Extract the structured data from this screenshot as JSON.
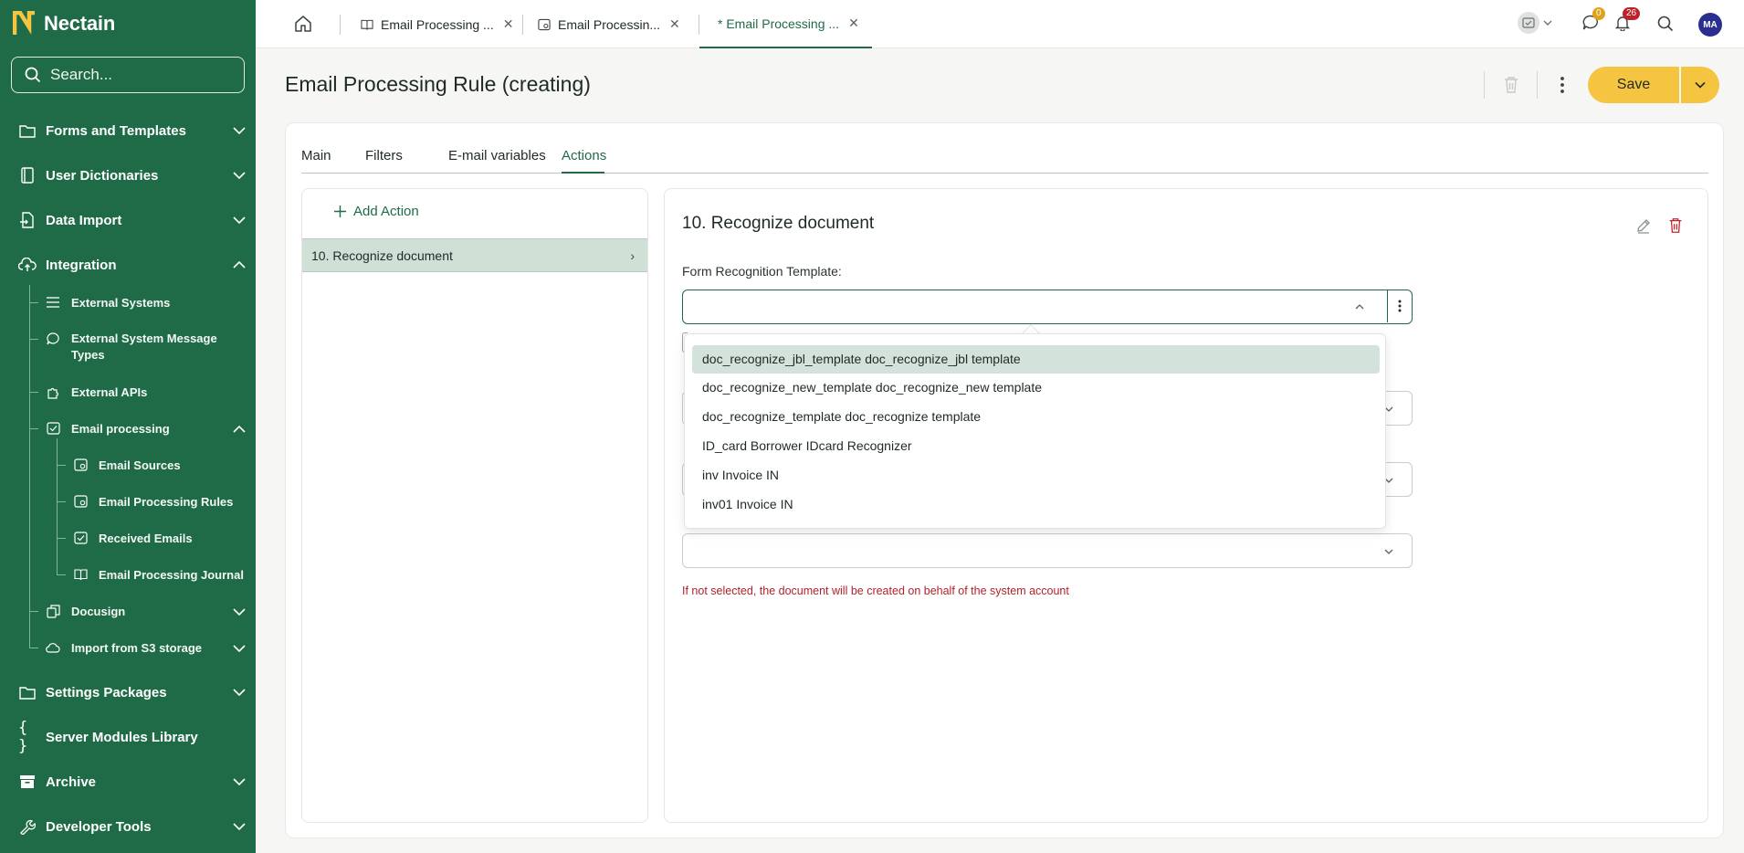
{
  "brand": {
    "name": "Nectain"
  },
  "sidebar": {
    "search_placeholder": "Search...",
    "items": [
      {
        "label": "Forms and Templates",
        "icon": "folder-icon",
        "expanded": false
      },
      {
        "label": "User Dictionaries",
        "icon": "book-icon",
        "expanded": false
      },
      {
        "label": "Data Import",
        "icon": "file-import-icon",
        "expanded": false
      },
      {
        "label": "Integration",
        "icon": "cloud-upload-icon",
        "expanded": true
      },
      {
        "label": "Settings Packages",
        "icon": "folder-icon",
        "expanded": false
      },
      {
        "label": "Server Modules Library",
        "icon": "braces-icon",
        "expanded": false
      },
      {
        "label": "Archive",
        "icon": "archive-icon",
        "expanded": false
      },
      {
        "label": "Developer Tools",
        "icon": "wrench-icon",
        "expanded": false
      }
    ],
    "integration_children": [
      {
        "label": "External Systems",
        "icon": "list-icon"
      },
      {
        "label": "External System Message Types",
        "icon": "message-icon"
      },
      {
        "label": "External APIs",
        "icon": "puzzle-icon"
      },
      {
        "label": "Email processing",
        "icon": "mail-check-icon",
        "expanded": true
      },
      {
        "label": "Docusign",
        "icon": "docs-icon",
        "expanded": false
      },
      {
        "label": "Import from S3 storage",
        "icon": "cloud-icon",
        "expanded": false
      }
    ],
    "email_children": [
      {
        "label": "Email Sources",
        "icon": "mail-settings-icon"
      },
      {
        "label": "Email Processing Rules",
        "icon": "mail-settings-icon"
      },
      {
        "label": "Received Emails",
        "icon": "mail-check-icon"
      },
      {
        "label": "Email Processing Journal",
        "icon": "book-open-icon"
      }
    ]
  },
  "topbar": {
    "tabs": [
      {
        "label": "Email Processing ...",
        "icon": "book-open-icon",
        "active": false
      },
      {
        "label": "Email Processin...",
        "icon": "mail-settings-icon",
        "active": false
      },
      {
        "label": "* Email Processing ...",
        "icon": "",
        "active": true
      }
    ],
    "chat_badge": "0",
    "notif_badge": "26",
    "avatar_initials": "MA"
  },
  "header": {
    "title": "Email Processing Rule (creating)",
    "save_label": "Save"
  },
  "content_tabs": [
    {
      "label": "Main",
      "active": false
    },
    {
      "label": "Filters",
      "active": false
    },
    {
      "label": "E-mail variables",
      "active": false
    },
    {
      "label": "Actions",
      "active": true
    }
  ],
  "actions_panel": {
    "add_label": "Add Action",
    "items": [
      {
        "label": "10. Recognize document",
        "selected": true
      }
    ]
  },
  "action_detail": {
    "title": "10. Recognize document",
    "template_label": "Form Recognition Template:",
    "template_value": "",
    "hint": "If not selected, the document will be created on behalf of the system account"
  },
  "template_dropdown": {
    "options": [
      "doc_recognize_jbl_template doc_recognize_jbl template",
      "doc_recognize_new_template doc_recognize_new template",
      "doc_recognize_template doc_recognize template",
      "ID_card Borrower IDcard Recognizer",
      "inv Invoice IN",
      "inv01 Invoice IN"
    ],
    "highlighted_index": 0
  },
  "colors": {
    "sidebar": "#1f6b47",
    "accent": "#1f6b47",
    "save": "#f5c542",
    "error": "#b0232b",
    "chat_badge": "#e0a21a",
    "notif_badge": "#c0222d"
  }
}
